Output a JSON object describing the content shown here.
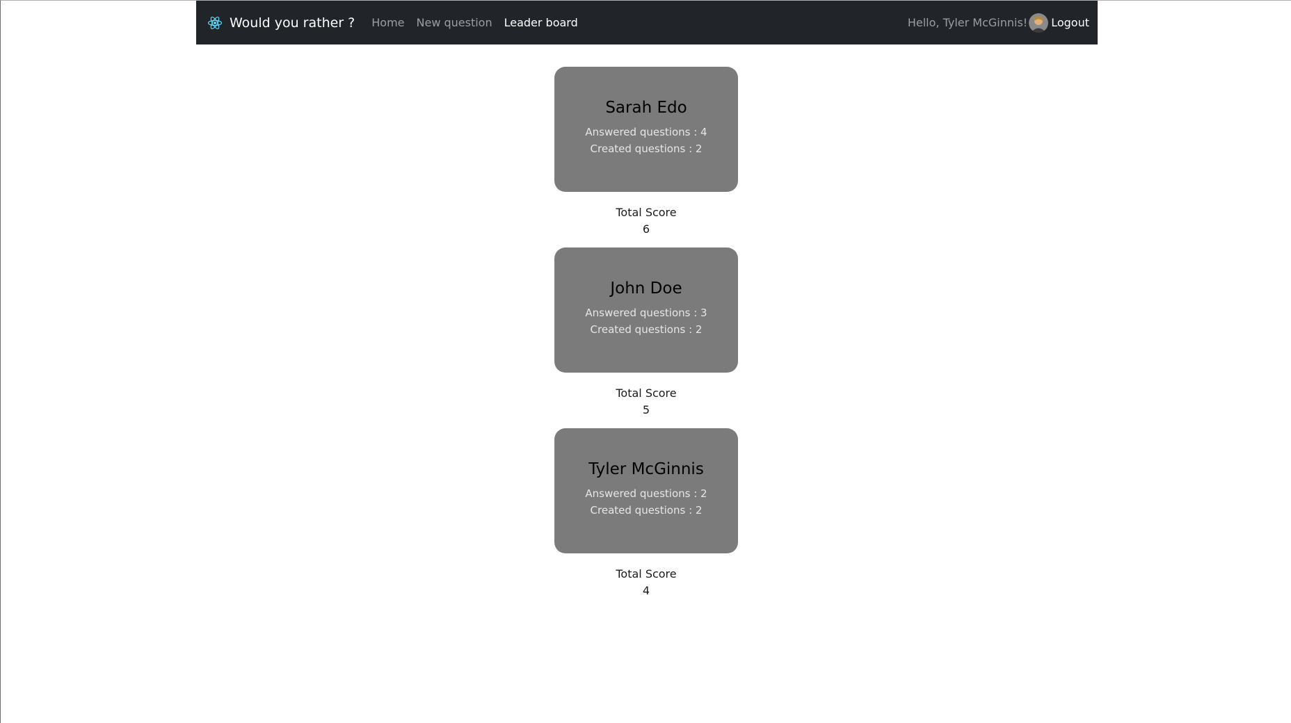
{
  "navbar": {
    "brand_title": "Would you rather ?",
    "links": [
      {
        "label": "Home",
        "active": false
      },
      {
        "label": "New question",
        "active": false
      },
      {
        "label": "Leader board",
        "active": true
      }
    ],
    "greeting": "Hello, Tyler McGinnis!",
    "logout_label": "Logout",
    "logo_icon": "react-atom-icon",
    "avatar_icon": "user-avatar"
  },
  "colors": {
    "navbar_bg": "#212529",
    "card_bg": "#7b7b7b",
    "logo_accent": "#61dafb"
  },
  "leaderboard": [
    {
      "name": "Sarah Edo",
      "answered": "Answered questions : 4",
      "created": "Created questions : 2",
      "score_label": "Total Score",
      "score": "6"
    },
    {
      "name": "John Doe",
      "answered": "Answered questions : 3",
      "created": "Created questions : 2",
      "score_label": "Total Score",
      "score": "5"
    },
    {
      "name": "Tyler McGinnis",
      "answered": "Answered questions : 2",
      "created": "Created questions : 2",
      "score_label": "Total Score",
      "score": "4"
    }
  ]
}
